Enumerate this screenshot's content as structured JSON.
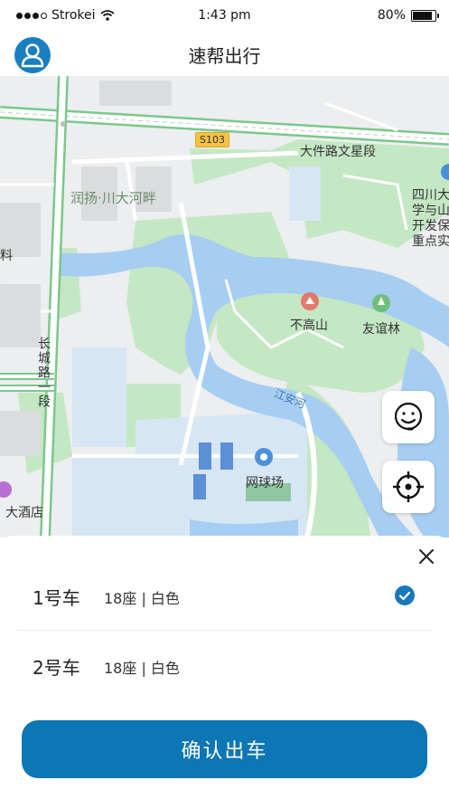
{
  "status_bar": {
    "carrier": "Strokei",
    "time": "1:43 pm",
    "battery": "80%"
  },
  "header": {
    "title": "速帮出行",
    "avatar_icon": "user-icon"
  },
  "map": {
    "road_badge": "S103",
    "labels": {
      "road_east": "大件路文星段",
      "compound": "润扬·川大河畔",
      "university": [
        "四川大",
        "学与山",
        "开发保",
        "重点实"
      ],
      "hill": "不高山",
      "forest": "友谊林",
      "road_vertical": "长城路一段",
      "river": "江安河",
      "tennis": "网球场",
      "hotel": "大酒店",
      "edge_char": "料"
    },
    "colors": {
      "water": "#a6cdf2",
      "green": "#c4e7c4",
      "road_border": "#7ac88b",
      "land": "#eceeef"
    },
    "buttons": {
      "service_icon": "customer-service-icon",
      "locate_icon": "crosshair-icon"
    }
  },
  "sheet": {
    "close_icon": "close-icon",
    "cars": [
      {
        "name": "1号车",
        "info": "18座 | 白色",
        "selected": true
      },
      {
        "name": "2号车",
        "info": "18座 | 白色",
        "selected": false
      }
    ],
    "confirm_label": "确认出车"
  },
  "colors": {
    "accent": "#0d76b5",
    "check": "#1978b8"
  }
}
